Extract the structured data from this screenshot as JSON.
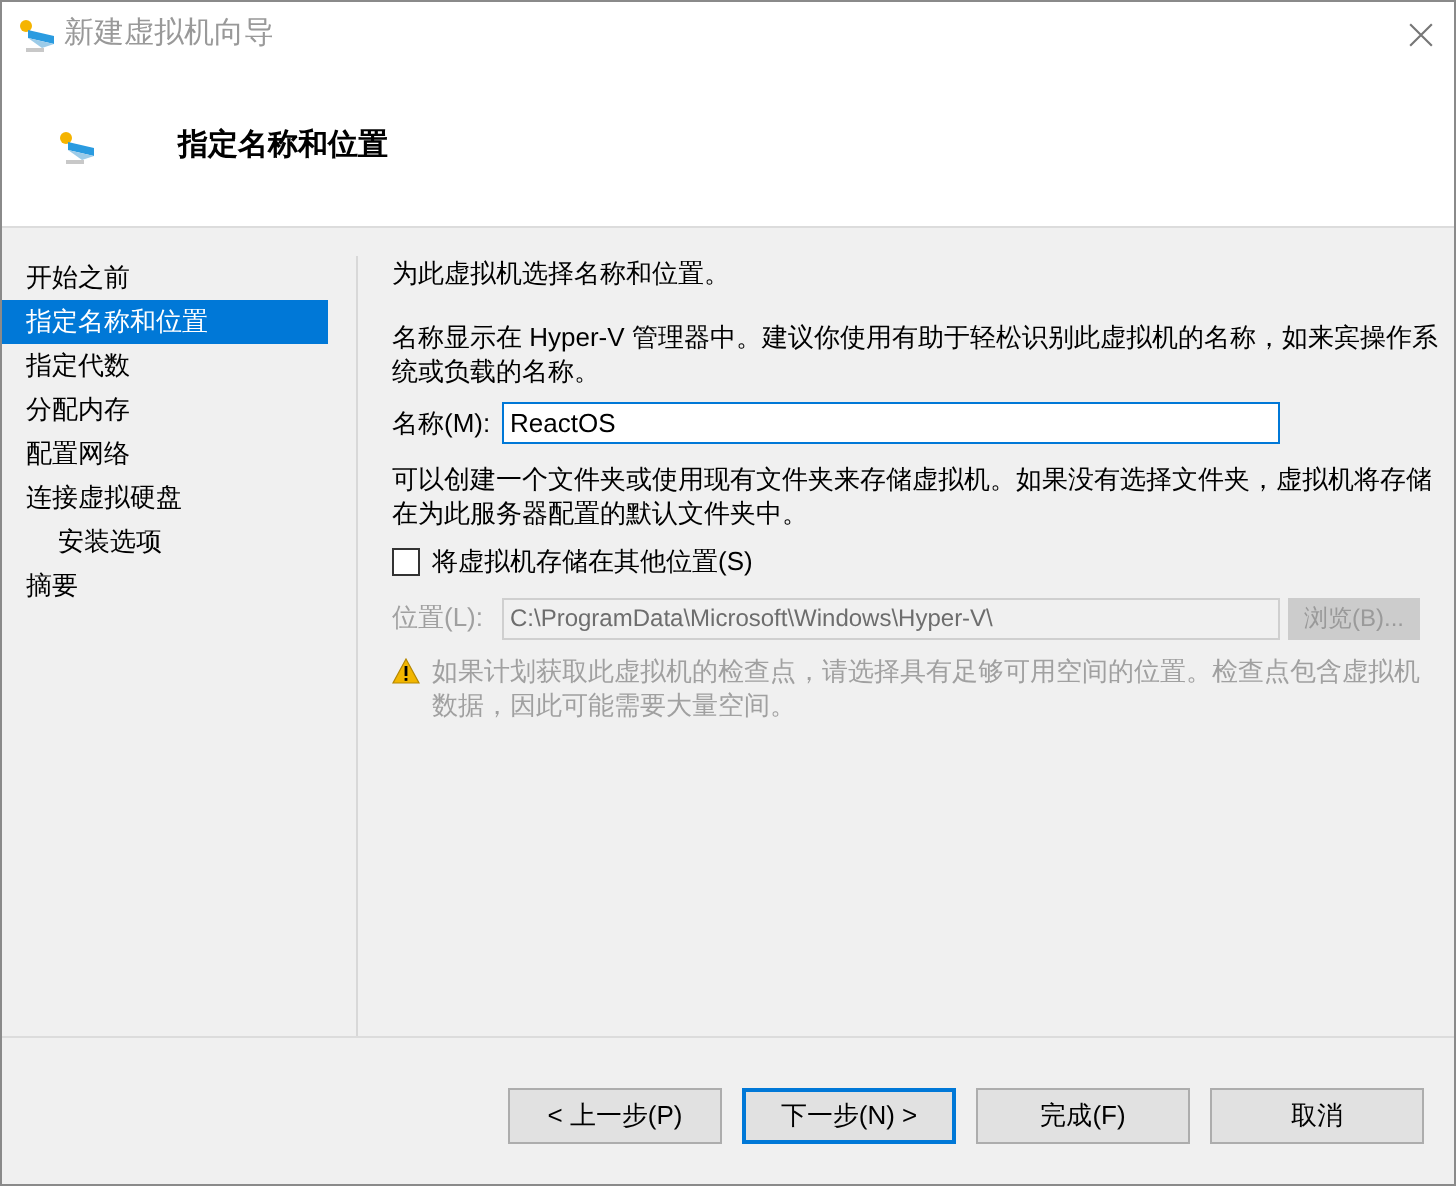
{
  "window": {
    "title": "新建虚拟机向导"
  },
  "header": {
    "title": "指定名称和位置"
  },
  "sidebar": {
    "items": [
      {
        "label": "开始之前",
        "selected": false
      },
      {
        "label": "指定名称和位置",
        "selected": true
      },
      {
        "label": "指定代数",
        "selected": false
      },
      {
        "label": "分配内存",
        "selected": false
      },
      {
        "label": "配置网络",
        "selected": false
      },
      {
        "label": "连接虚拟硬盘",
        "selected": false,
        "children": [
          {
            "label": "安装选项",
            "selected": false
          }
        ]
      },
      {
        "label": "摘要",
        "selected": false
      }
    ]
  },
  "content": {
    "intro": "为此虚拟机选择名称和位置。",
    "name_help": "名称显示在 Hyper-V 管理器中。建议你使用有助于轻松识别此虚拟机的名称，如来宾操作系统或负载的名称。",
    "name_label": "名称(M):",
    "name_value": "ReactOS",
    "location_help": "可以创建一个文件夹或使用现有文件夹来存储虚拟机。如果没有选择文件夹，虚拟机将存储在为此服务器配置的默认文件夹中。",
    "store_elsewhere": {
      "label": "将虚拟机存储在其他位置(S)",
      "checked": false
    },
    "location_label": "位置(L):",
    "location_value": "C:\\ProgramData\\Microsoft\\Windows\\Hyper-V\\",
    "location_disabled": true,
    "browse_button": "浏览(B)...",
    "warning": "如果计划获取此虚拟机的检查点，请选择具有足够可用空间的位置。检查点包含虚拟机数据，因此可能需要大量空间。"
  },
  "buttons": [
    {
      "label": "< 上一步(P)",
      "default": false
    },
    {
      "label": "下一步(N) >",
      "default": true
    },
    {
      "label": "完成(F)",
      "default": false
    },
    {
      "label": "取消",
      "default": false
    }
  ]
}
